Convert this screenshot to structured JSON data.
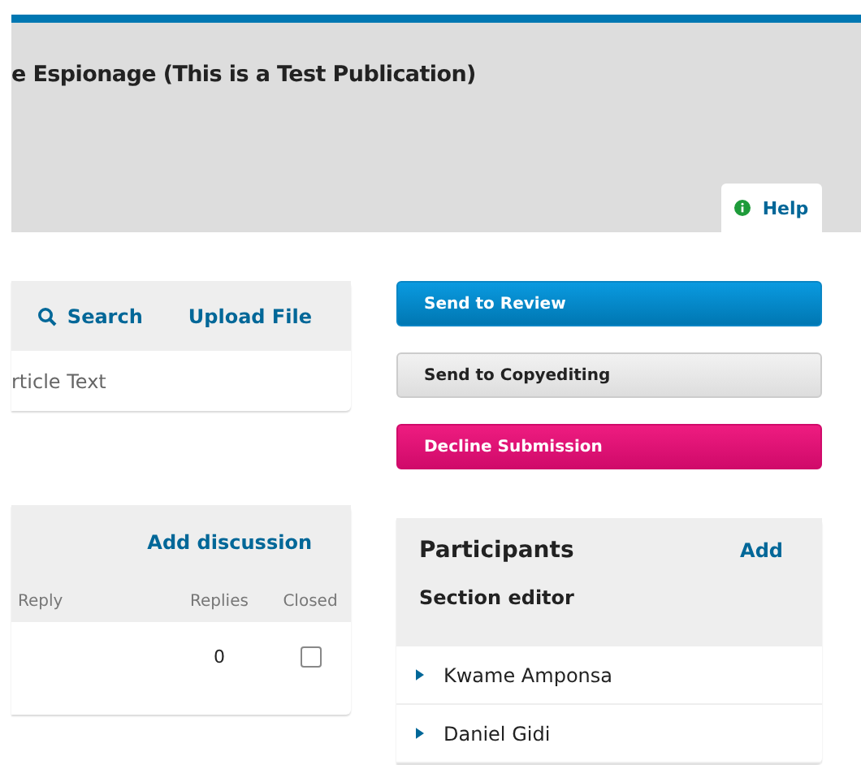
{
  "header": {
    "title": "e Espionage (This is a Test Publication)",
    "help": "Help"
  },
  "files": {
    "search": "Search",
    "upload": "Upload File",
    "rows": [
      {
        "name": "rticle Text"
      }
    ]
  },
  "discussions": {
    "add": "Add discussion",
    "columns": [
      "Reply",
      "Replies",
      "Closed"
    ],
    "rows": [
      {
        "replies": "0",
        "closed": false
      }
    ]
  },
  "actions": [
    {
      "label": "Send to Review",
      "kind": "primary"
    },
    {
      "label": "Send to Copyediting",
      "kind": "default"
    },
    {
      "label": "Decline Submission",
      "kind": "danger"
    }
  ],
  "participants": {
    "title": "Participants",
    "add": "Add",
    "group": "Section editor",
    "items": [
      {
        "name": "Kwame Amponsa",
        "expanded": false
      },
      {
        "name": "Daniel Gidi",
        "expanded": false
      }
    ]
  }
}
